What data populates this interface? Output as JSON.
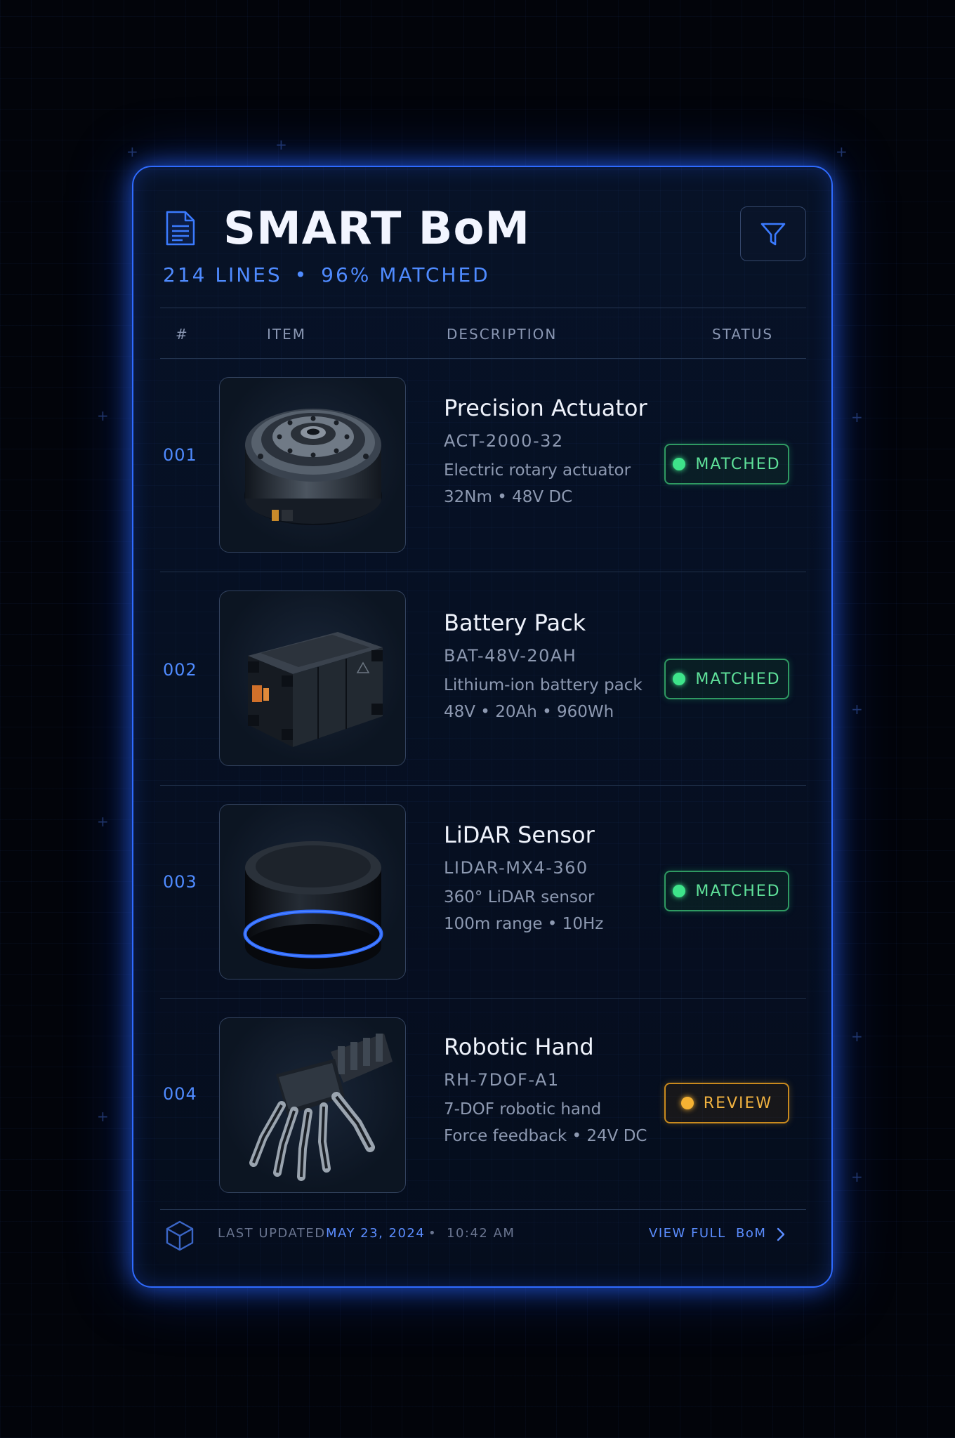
{
  "header": {
    "title": "SMART BoM",
    "lines": "214 LINES",
    "separator": "•",
    "matched": "96% MATCHED"
  },
  "columns": {
    "num": "#",
    "item": "ITEM",
    "description": "DESCRIPTION",
    "status": "STATUS"
  },
  "rows": [
    {
      "num": "001",
      "name": "Precision Actuator",
      "code": "ACT-2000-32",
      "desc1": "Electric rotary actuator",
      "desc2": "32Nm • 48V DC",
      "status": "MATCHED",
      "icon": "actuator-image"
    },
    {
      "num": "002",
      "name": "Battery Pack",
      "code": "BAT-48V-20AH",
      "desc1": "Lithium-ion battery pack",
      "desc2": "48V • 20Ah • 960Wh",
      "status": "MATCHED",
      "icon": "battery-image"
    },
    {
      "num": "003",
      "name": "LiDAR Sensor",
      "code": "LIDAR-MX4-360",
      "desc1": "360° LiDAR sensor",
      "desc2": "100m range • 10Hz",
      "status": "MATCHED",
      "icon": "lidar-image"
    },
    {
      "num": "004",
      "name": "Robotic Hand",
      "code": "RH-7DOF-A1",
      "desc1": "7-DOF robotic hand",
      "desc2": "Force feedback • 24V DC",
      "status": "REVIEW",
      "icon": "robotic-hand-image"
    }
  ],
  "footer": {
    "updated_label": "LAST UPDATED",
    "date": "MAY 23, 2024",
    "separator": "•",
    "time": "10:42 AM",
    "view_link": "VIEW FULL  BoM"
  },
  "colors": {
    "accent": "#2f6bff",
    "matched": "#3ee48a",
    "review": "#f5b233",
    "background": "#02040a"
  }
}
